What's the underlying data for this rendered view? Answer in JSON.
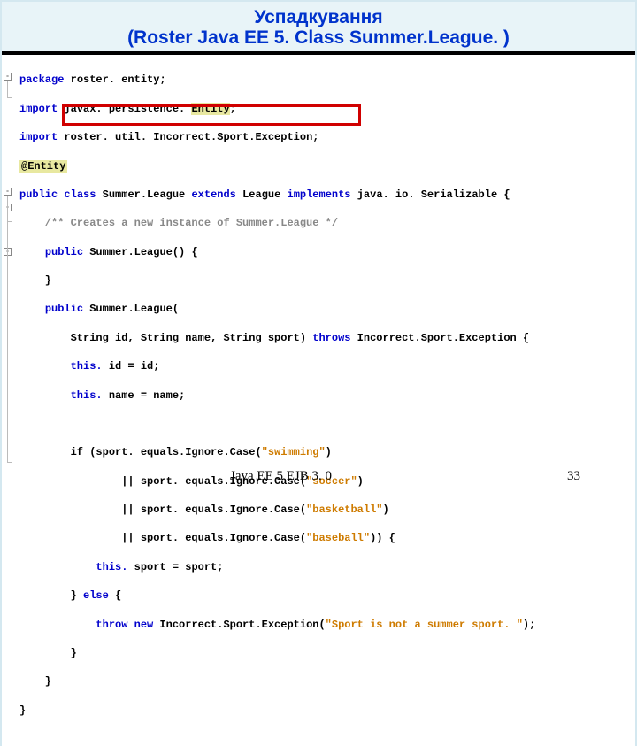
{
  "header": {
    "title_line1": "Успадкування",
    "title_line2": "(Roster Java EE 5. Class Summer.League. )"
  },
  "code": {
    "l1_kw": "package",
    "l1_rest": " roster. entity;",
    "l2_kw": "import",
    "l2_mid": " javax. persistence. ",
    "l2_ent": "Entity",
    "l2_end": ";",
    "l3_kw": "import",
    "l3_rest": " roster. util. Incorrect.Sport.Exception;",
    "l4": "@Entity",
    "l5_kw1": "public",
    "l5_kw2": "class",
    "l5_cls": " Summer.League ",
    "l5_kw3": "extends",
    "l5_sup": " League ",
    "l5_kw4": "implements",
    "l5_rest": " java. io. Serializable {",
    "l6": "    /** Creates a new instance of Summer.League */",
    "l7_kw": "public",
    "l7_rest": " Summer.League() {",
    "l8": "    }",
    "l9_kw": "public",
    "l9_rest": " Summer.League(",
    "l10a": "        String id, String name, String sport) ",
    "l10_kw": "throws",
    "l10b": " Incorrect.Sport.Exception {",
    "l11_kw": "this.",
    "l11_rest": " id = id;",
    "l12_kw": "this.",
    "l12_rest": " name = name;",
    "l14a": "        if (sport. equals.Ignore.Case(",
    "l14s": "\"swimming\"",
    "l14b": ")",
    "l15a": "                || sport. equals.Ignore.Case(",
    "l15s": "\"soccer\"",
    "l15b": ")",
    "l16a": "                || sport. equals.Ignore.Case(",
    "l16s": "\"basketball\"",
    "l16b": ")",
    "l17a": "                || sport. equals.Ignore.Case(",
    "l17s": "\"baseball\"",
    "l17b": ")) {",
    "l18_kw": "this.",
    "l18_rest": " sport = sport;",
    "l19a": "        } ",
    "l19_kw": "else",
    "l19b": " {",
    "l20_kw": "throw new",
    "l20a": " Incorrect.Sport.Exception(",
    "l20s": "\"Sport is not a summer sport. \"",
    "l20b": ");",
    "l21": "        }",
    "l22": "    }",
    "l23": "}"
  },
  "footer": {
    "center": "Java EE 5 EJB 3. 0",
    "page": "33"
  }
}
